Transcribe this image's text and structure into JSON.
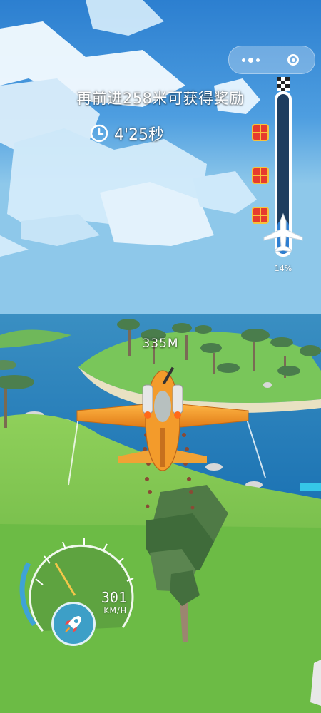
{
  "hud": {
    "goal_text": "再前进258米可获得奖励",
    "timer": "4'25秒",
    "distance": "335M"
  },
  "progress": {
    "percent_label": "14%",
    "fraction": 0.14,
    "rewards": [
      "gift-chest-icon",
      "gift-chest-icon",
      "gift-chest-icon"
    ]
  },
  "speedometer": {
    "value": "301",
    "unit": "KM/H"
  },
  "icons": {
    "timer": "clock-icon",
    "boost": "rocket-icon",
    "flag": "checkered-flag-icon",
    "marker": "airplane-icon"
  },
  "colors": {
    "sky": "#3f8fd6",
    "sea": "#2ba7d8",
    "grass": "#7cc94b",
    "plane": "#f09a2a",
    "progress_fill": "#2f7fd1",
    "reward": "#e63b2e"
  }
}
